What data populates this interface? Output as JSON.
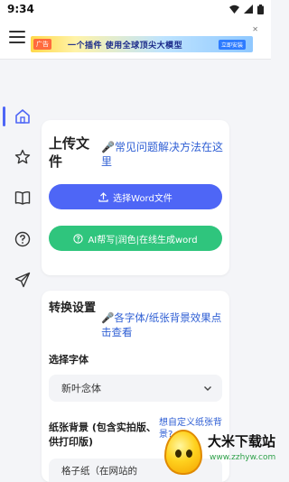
{
  "status_bar": {
    "time": "9:34"
  },
  "ad": {
    "tag": "广告",
    "text": "一个插件 使用全球顶尖大模型",
    "button": "立即安装"
  },
  "nav": {
    "items": [
      "home",
      "favorites",
      "guide",
      "help",
      "share"
    ]
  },
  "upload_card": {
    "title": "上传文件",
    "faq_link": "常见问题解决方法在这里",
    "select_button": "选择Word文件",
    "ai_button": "AI帮写|润色|在线生成word"
  },
  "settings_card": {
    "title": "转换设置",
    "effects_link": "各字体/纸张背景效果点击查看",
    "font_label": "选择字体",
    "font_value": "新叶念体",
    "paper_label": "纸张背景 (包含实拍版、供打印版)",
    "custom_paper_link": "想自定义纸张背景?",
    "paper_value": "格子纸（在网站的"
  },
  "watermark": {
    "title": "大米下载站",
    "url": "www.zzhyw.com"
  },
  "colors": {
    "primary": "#4e66f6",
    "green": "#2fc57d",
    "link": "#2f5fd4"
  }
}
